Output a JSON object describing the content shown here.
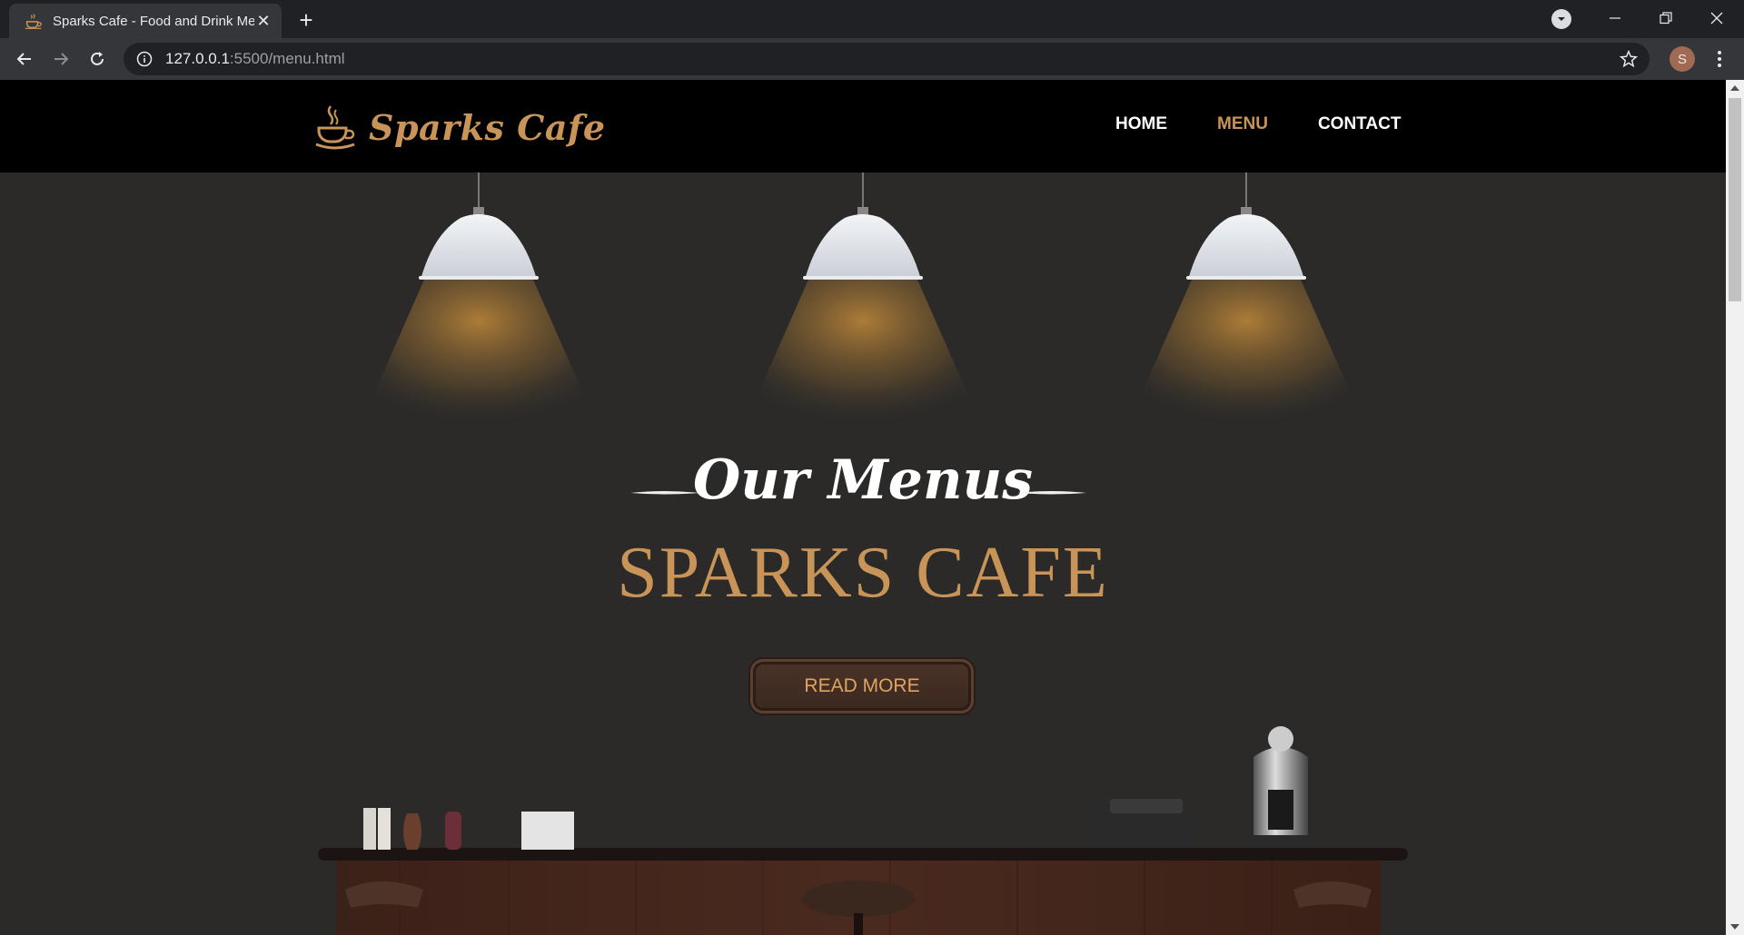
{
  "browser": {
    "tab_title": "Sparks Cafe - Food and Drink Me",
    "new_tab": "+",
    "url_host": "127.0.0.1",
    "url_path": ":5500/menu.html",
    "profile_initial": "S"
  },
  "site": {
    "brand": "Sparks Cafe",
    "nav": [
      {
        "label": "HOME"
      },
      {
        "label": "MENU",
        "active": true
      },
      {
        "label": "CONTACT"
      }
    ],
    "hero": {
      "script_title": "Our Menus",
      "main_title": "SPARKS CAFE",
      "button_label": "READ MORE"
    }
  },
  "colors": {
    "accent": "#c99457",
    "header_bg": "#000000",
    "page_bg": "#2b2a29"
  }
}
